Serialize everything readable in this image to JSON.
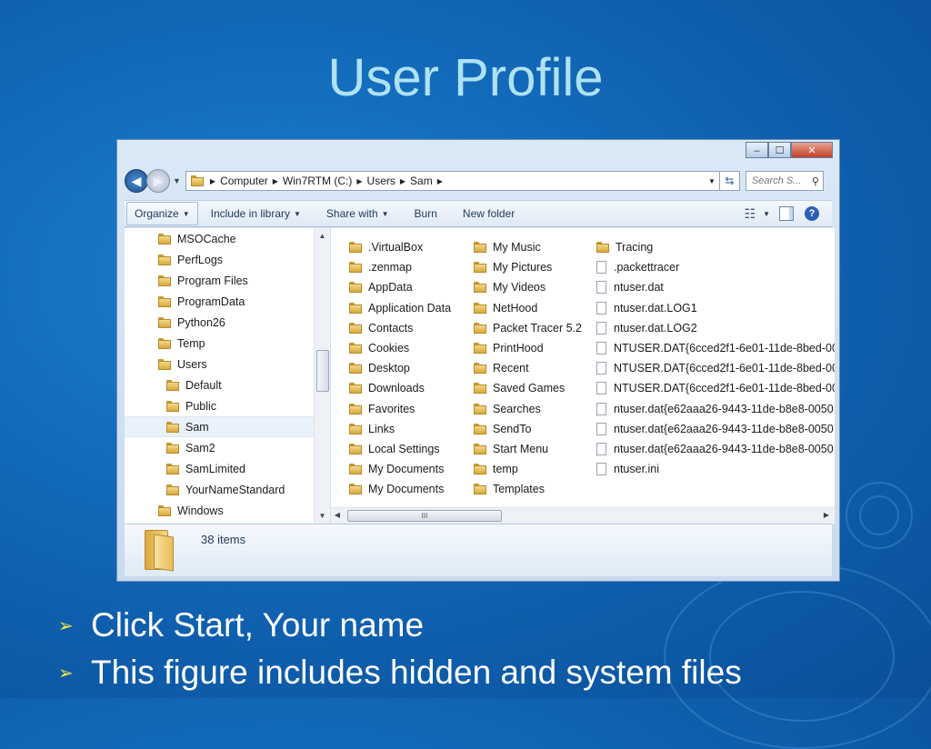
{
  "slide": {
    "title": "User Profile",
    "bullets": [
      "Click Start, Your name",
      "This figure includes hidden and system files"
    ]
  },
  "window": {
    "caption_buttons": {
      "minimize": "‒",
      "maximize": "☐",
      "close": "✕"
    },
    "address_bar": {
      "segments": [
        "Computer",
        "Win7RTM (C:)",
        "Users",
        "Sam"
      ],
      "refresh_icon": "refresh-icon"
    },
    "search": {
      "placeholder": "Search S..."
    },
    "toolbar": {
      "organize": "Organize",
      "include_in_library": "Include in library",
      "share_with": "Share with",
      "burn": "Burn",
      "new_folder": "New folder"
    },
    "nav_pane": {
      "items": [
        {
          "label": "MSOCache",
          "indent": 0
        },
        {
          "label": "PerfLogs",
          "indent": 0
        },
        {
          "label": "Program Files",
          "indent": 0
        },
        {
          "label": "ProgramData",
          "indent": 0
        },
        {
          "label": "Python26",
          "indent": 0
        },
        {
          "label": "Temp",
          "indent": 0
        },
        {
          "label": "Users",
          "indent": 0
        },
        {
          "label": "Default",
          "indent": 1
        },
        {
          "label": "Public",
          "indent": 1
        },
        {
          "label": "Sam",
          "indent": 1,
          "selected": true
        },
        {
          "label": "Sam2",
          "indent": 1
        },
        {
          "label": "SamLimited",
          "indent": 1
        },
        {
          "label": "YourNameStandard",
          "indent": 1
        },
        {
          "label": "Windows",
          "indent": 0
        }
      ]
    },
    "content": {
      "columns": [
        [
          {
            "label": ".VirtualBox",
            "kind": "folder"
          },
          {
            "label": ".zenmap",
            "kind": "folder"
          },
          {
            "label": "AppData",
            "kind": "folder"
          },
          {
            "label": "Application Data",
            "kind": "shortcut"
          },
          {
            "label": "Contacts",
            "kind": "folder"
          },
          {
            "label": "Cookies",
            "kind": "shortcut"
          },
          {
            "label": "Desktop",
            "kind": "folder"
          },
          {
            "label": "Downloads",
            "kind": "folder"
          },
          {
            "label": "Favorites",
            "kind": "folder"
          },
          {
            "label": "Links",
            "kind": "folder"
          },
          {
            "label": "Local Settings",
            "kind": "shortcut"
          },
          {
            "label": "My Documents",
            "kind": "folder"
          },
          {
            "label": "My Documents",
            "kind": "shortcut"
          }
        ],
        [
          {
            "label": "My Music",
            "kind": "folder"
          },
          {
            "label": "My Pictures",
            "kind": "folder"
          },
          {
            "label": "My Videos",
            "kind": "folder"
          },
          {
            "label": "NetHood",
            "kind": "shortcut"
          },
          {
            "label": "Packet Tracer 5.2",
            "kind": "folder"
          },
          {
            "label": "PrintHood",
            "kind": "shortcut"
          },
          {
            "label": "Recent",
            "kind": "shortcut"
          },
          {
            "label": "Saved Games",
            "kind": "folder"
          },
          {
            "label": "Searches",
            "kind": "folder"
          },
          {
            "label": "SendTo",
            "kind": "shortcut"
          },
          {
            "label": "Start Menu",
            "kind": "shortcut"
          },
          {
            "label": "temp",
            "kind": "folder"
          },
          {
            "label": "Templates",
            "kind": "shortcut"
          }
        ],
        [
          {
            "label": "Tracing",
            "kind": "folder"
          },
          {
            "label": ".packettracer",
            "kind": "file"
          },
          {
            "label": "ntuser.dat",
            "kind": "file"
          },
          {
            "label": "ntuser.dat.LOG1",
            "kind": "file"
          },
          {
            "label": "ntuser.dat.LOG2",
            "kind": "file"
          },
          {
            "label": "NTUSER.DAT{6cced2f1-6e01-11de-8bed-00",
            "kind": "file"
          },
          {
            "label": "NTUSER.DAT{6cced2f1-6e01-11de-8bed-00",
            "kind": "file"
          },
          {
            "label": "NTUSER.DAT{6cced2f1-6e01-11de-8bed-00",
            "kind": "file"
          },
          {
            "label": "ntuser.dat{e62aaa26-9443-11de-b8e8-0050",
            "kind": "file"
          },
          {
            "label": "ntuser.dat{e62aaa26-9443-11de-b8e8-0050",
            "kind": "file"
          },
          {
            "label": "ntuser.dat{e62aaa26-9443-11de-b8e8-0050",
            "kind": "file"
          },
          {
            "label": "ntuser.ini",
            "kind": "file"
          }
        ]
      ],
      "hscroll_grip": "III"
    },
    "details_pane": {
      "item_count": "38 items"
    }
  },
  "colors": {
    "background": "#0f5fae",
    "title": "#aee2f2",
    "bullet_marker": "#f4e64a",
    "bullet_text": "#ffffff"
  }
}
